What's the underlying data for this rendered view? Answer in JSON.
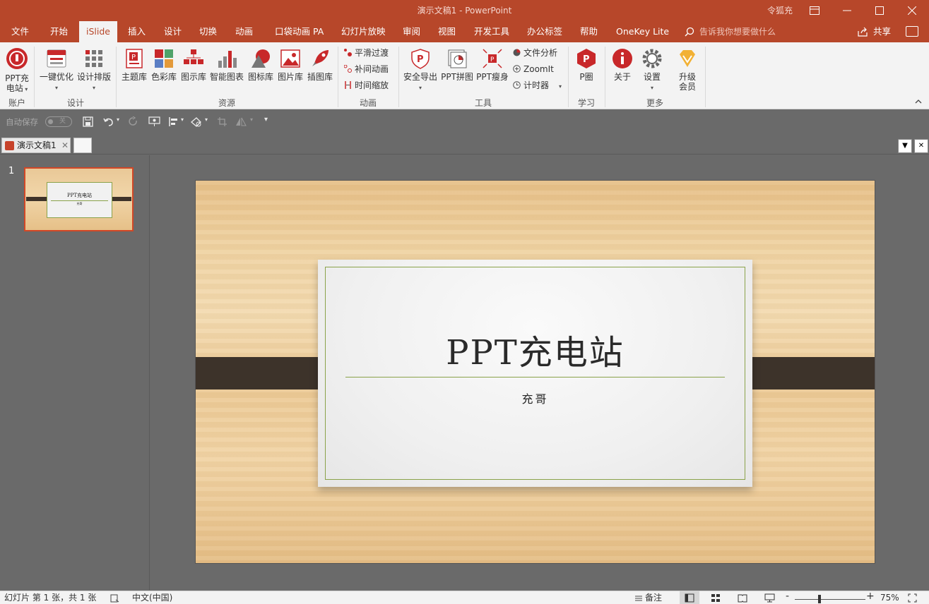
{
  "titlebar": {
    "title": "演示文稿1  -  PowerPoint",
    "user": "令狐充",
    "ribbon_display_icon": "ribbon-display-icon",
    "minimize": "—",
    "maximize": "☐",
    "close": "✕"
  },
  "tabs": [
    {
      "label": "文件"
    },
    {
      "label": "开始"
    },
    {
      "label": "iSlide"
    },
    {
      "label": "插入"
    },
    {
      "label": "设计"
    },
    {
      "label": "切换"
    },
    {
      "label": "动画"
    },
    {
      "label": "口袋动画 PA"
    },
    {
      "label": "幻灯片放映"
    },
    {
      "label": "审阅"
    },
    {
      "label": "视图"
    },
    {
      "label": "开发工具"
    },
    {
      "label": "办公标签"
    },
    {
      "label": "帮助"
    },
    {
      "label": "OneKey Lite"
    }
  ],
  "active_tab": "iSlide",
  "tellme": {
    "placeholder": "告诉我你想要做什么"
  },
  "share": {
    "label": "共享"
  },
  "ribbon": {
    "account": {
      "btn_line1": "PPT充",
      "btn_line2": "电站",
      "group": "账户"
    },
    "design": {
      "optimize": "一键优化",
      "layout": "设计排版",
      "group": "设计"
    },
    "resources": {
      "items": [
        "主题库",
        "色彩库",
        "图示库",
        "智能图表",
        "图标库",
        "图片库",
        "插图库"
      ],
      "group": "资源"
    },
    "animation": {
      "items": [
        "平滑过渡",
        "补间动画",
        "时间缩放"
      ],
      "group": "动画"
    },
    "tools": {
      "export": "安全导出",
      "collage": "PPT拼图",
      "slim": "PPT瘦身",
      "small": [
        "文件分析",
        "ZoomIt",
        "计时器"
      ],
      "group": "工具"
    },
    "learn": {
      "label": "P圈",
      "group": "学习"
    },
    "more": {
      "about": "关于",
      "settings": "设置",
      "upgrade_line1": "升级",
      "upgrade_line2": "会员",
      "group": "更多"
    }
  },
  "qat": {
    "autosave": "自动保存",
    "toggle": "关"
  },
  "document": {
    "tab_label": "演示文稿1",
    "close": "✕"
  },
  "thumbnails": [
    {
      "number": "1",
      "title": "PPT充电站",
      "subtitle": "充哥"
    }
  ],
  "slide": {
    "title": "PPT充电站",
    "subtitle": "充哥"
  },
  "statusbar": {
    "slide_info": "幻灯片 第 1 张，共 1 张",
    "language": "中文(中国)",
    "notes": "备注",
    "zoom": "75%"
  },
  "colors": {
    "accent": "#b7472a",
    "frame": "#8aa24a",
    "band": "#3d332a"
  }
}
